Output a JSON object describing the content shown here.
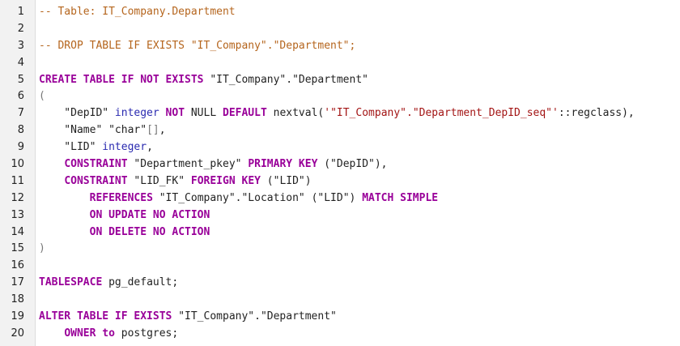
{
  "editor": {
    "lines": [
      {
        "num": "1",
        "tokens": [
          {
            "t": "-- Table: IT_Company.Department",
            "c": "cm"
          }
        ]
      },
      {
        "num": "2",
        "tokens": []
      },
      {
        "num": "3",
        "tokens": [
          {
            "t": "-- DROP TABLE IF EXISTS \"IT_Company\".\"Department\";",
            "c": "cm"
          }
        ]
      },
      {
        "num": "4",
        "tokens": []
      },
      {
        "num": "5",
        "tokens": [
          {
            "t": "CREATE TABLE IF NOT EXISTS",
            "c": "kw"
          },
          {
            "t": " \"IT_Company\".\"Department\"",
            "c": "id"
          }
        ]
      },
      {
        "num": "6",
        "tokens": [
          {
            "t": "(",
            "c": "pn"
          }
        ]
      },
      {
        "num": "7",
        "tokens": [
          {
            "t": "    \"DepID\" ",
            "c": "id"
          },
          {
            "t": "integer",
            "c": "ty"
          },
          {
            "t": " ",
            "c": "id"
          },
          {
            "t": "NOT",
            "c": "kw"
          },
          {
            "t": " NULL ",
            "c": "id"
          },
          {
            "t": "DEFAULT",
            "c": "kw"
          },
          {
            "t": " nextval(",
            "c": "id"
          },
          {
            "t": "'\"IT_Company\".\"Department_DepID_seq\"'",
            "c": "str"
          },
          {
            "t": "::regclass),",
            "c": "id"
          }
        ]
      },
      {
        "num": "8",
        "tokens": [
          {
            "t": "    \"Name\" \"char\"",
            "c": "id"
          },
          {
            "t": "[]",
            "c": "pn"
          },
          {
            "t": ",",
            "c": "id"
          }
        ]
      },
      {
        "num": "9",
        "tokens": [
          {
            "t": "    \"LID\" ",
            "c": "id"
          },
          {
            "t": "integer",
            "c": "ty"
          },
          {
            "t": ",",
            "c": "id"
          }
        ]
      },
      {
        "num": "10",
        "tokens": [
          {
            "t": "    ",
            "c": "id"
          },
          {
            "t": "CONSTRAINT",
            "c": "kw"
          },
          {
            "t": " \"Department_pkey\" ",
            "c": "id"
          },
          {
            "t": "PRIMARY KEY",
            "c": "kw"
          },
          {
            "t": " (\"DepID\"),",
            "c": "id"
          }
        ]
      },
      {
        "num": "11",
        "tokens": [
          {
            "t": "    ",
            "c": "id"
          },
          {
            "t": "CONSTRAINT",
            "c": "kw"
          },
          {
            "t": " \"LID_FK\" ",
            "c": "id"
          },
          {
            "t": "FOREIGN KEY",
            "c": "kw"
          },
          {
            "t": " (\"LID\")",
            "c": "id"
          }
        ]
      },
      {
        "num": "12",
        "tokens": [
          {
            "t": "        ",
            "c": "id"
          },
          {
            "t": "REFERENCES",
            "c": "kw"
          },
          {
            "t": " \"IT_Company\".\"Location\" (\"LID\") ",
            "c": "id"
          },
          {
            "t": "MATCH SIMPLE",
            "c": "kw"
          }
        ]
      },
      {
        "num": "13",
        "tokens": [
          {
            "t": "        ",
            "c": "id"
          },
          {
            "t": "ON UPDATE NO ACTION",
            "c": "kw"
          }
        ]
      },
      {
        "num": "14",
        "tokens": [
          {
            "t": "        ",
            "c": "id"
          },
          {
            "t": "ON DELETE NO ACTION",
            "c": "kw"
          }
        ]
      },
      {
        "num": "15",
        "tokens": [
          {
            "t": ")",
            "c": "pn"
          }
        ]
      },
      {
        "num": "16",
        "tokens": []
      },
      {
        "num": "17",
        "tokens": [
          {
            "t": "TABLESPACE",
            "c": "kw"
          },
          {
            "t": " pg_default;",
            "c": "id"
          }
        ]
      },
      {
        "num": "18",
        "tokens": []
      },
      {
        "num": "19",
        "tokens": [
          {
            "t": "ALTER TABLE IF EXISTS",
            "c": "kw"
          },
          {
            "t": " \"IT_Company\".\"Department\"",
            "c": "id"
          }
        ]
      },
      {
        "num": "20",
        "tokens": [
          {
            "t": "    ",
            "c": "id"
          },
          {
            "t": "OWNER",
            "c": "kw"
          },
          {
            "t": " ",
            "c": "id"
          },
          {
            "t": "to",
            "c": "kw"
          },
          {
            "t": " postgres;",
            "c": "id"
          }
        ]
      }
    ]
  }
}
